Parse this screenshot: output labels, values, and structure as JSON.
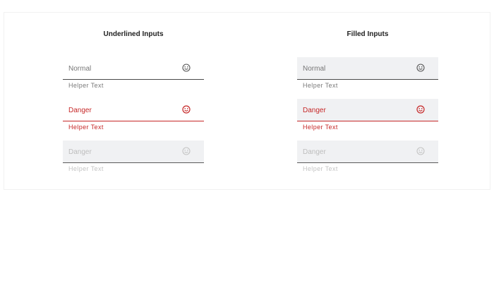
{
  "colors": {
    "danger": "#c62828",
    "filled_bg": "#f0f1f3",
    "normal_text": "#777777",
    "disabled_text": "#bdbdbd"
  },
  "underlined": {
    "title": "Underlined Inputs",
    "fields": [
      {
        "value": "Normal",
        "helper": "Helper Text",
        "state": "normal",
        "icon": "smiley-icon"
      },
      {
        "value": "Danger",
        "helper": "Helper Text",
        "state": "danger",
        "icon": "smiley-icon"
      },
      {
        "value": "Danger",
        "helper": "Helper Text",
        "state": "disabled",
        "icon": "smiley-icon"
      }
    ]
  },
  "filled": {
    "title": "Filled Inputs",
    "fields": [
      {
        "value": "Normal",
        "helper": "Helper Text",
        "state": "normal",
        "icon": "smiley-icon"
      },
      {
        "value": "Danger",
        "helper": "Helper Text",
        "state": "danger",
        "icon": "smiley-icon"
      },
      {
        "value": "Danger",
        "helper": "Helper Text",
        "state": "disabled",
        "icon": "smiley-icon"
      }
    ]
  }
}
